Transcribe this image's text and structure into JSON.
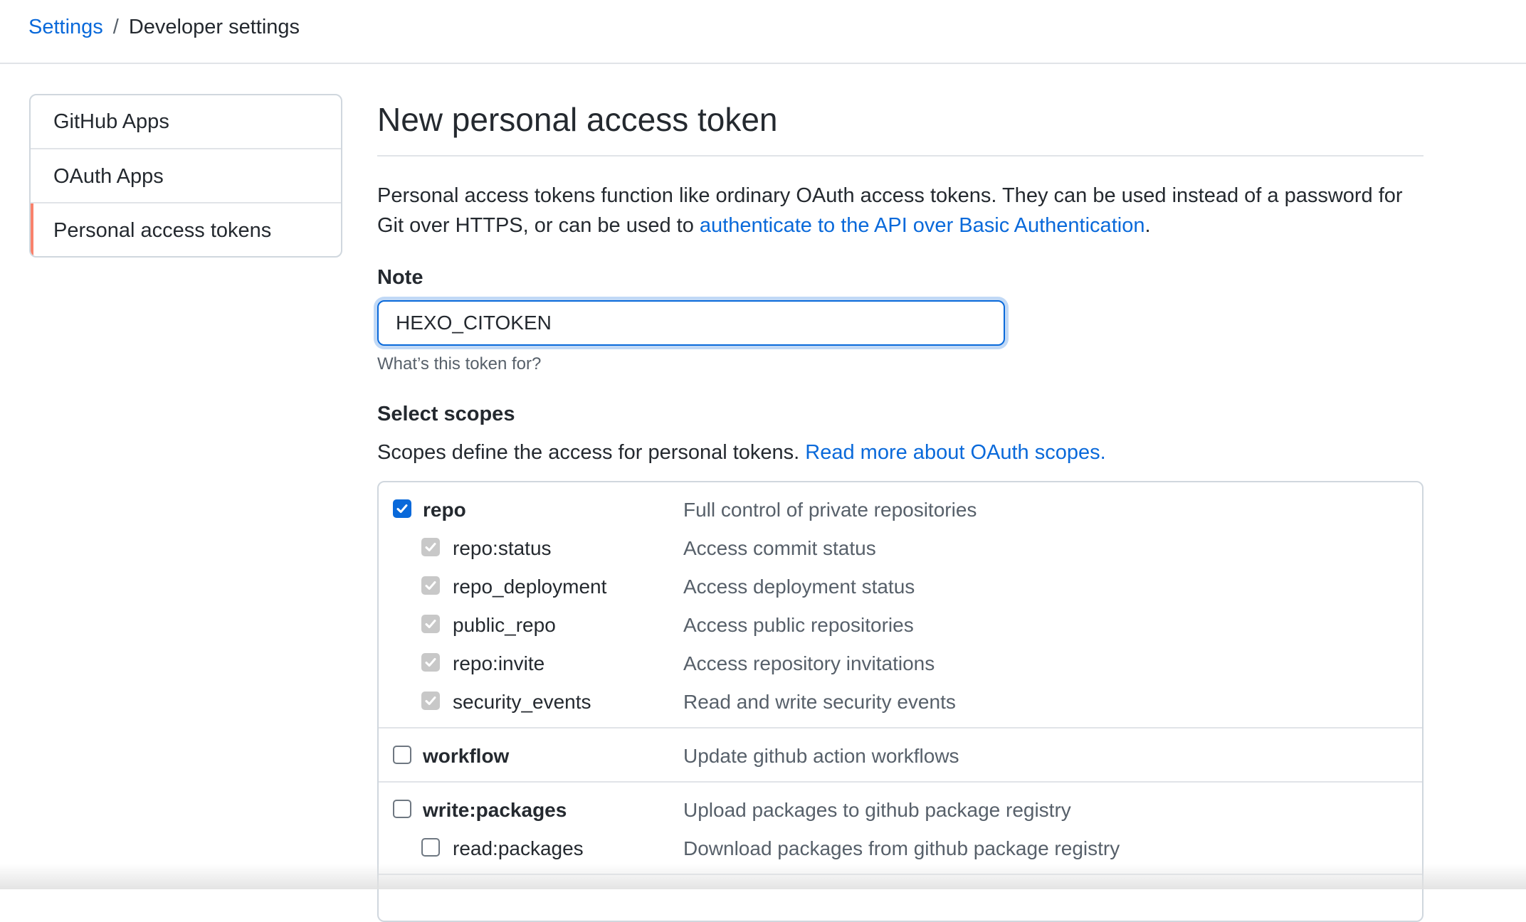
{
  "breadcrumb": {
    "root": "Settings",
    "separator": "/",
    "current": "Developer settings"
  },
  "sidebar": {
    "items": [
      {
        "label": "GitHub Apps",
        "selected": false
      },
      {
        "label": "OAuth Apps",
        "selected": false
      },
      {
        "label": "Personal access tokens",
        "selected": true
      }
    ]
  },
  "main": {
    "title": "New personal access token",
    "intro_text": "Personal access tokens function like ordinary OAuth access tokens. They can be used instead of a password for Git over HTTPS, or can be used to ",
    "intro_link": "authenticate to the API over Basic Authentication",
    "intro_end": ".",
    "note": {
      "label": "Note",
      "value": "HEXO_CITOKEN",
      "help": "What’s this token for?"
    },
    "scopes": {
      "title": "Select scopes",
      "desc": "Scopes define the access for personal tokens. ",
      "link": "Read more about OAuth scopes.",
      "groups": [
        {
          "name": "repo",
          "description": "Full control of private repositories",
          "checked": true,
          "children": [
            {
              "name": "repo:status",
              "description": "Access commit status",
              "checked": true
            },
            {
              "name": "repo_deployment",
              "description": "Access deployment status",
              "checked": true
            },
            {
              "name": "public_repo",
              "description": "Access public repositories",
              "checked": true
            },
            {
              "name": "repo:invite",
              "description": "Access repository invitations",
              "checked": true
            },
            {
              "name": "security_events",
              "description": "Read and write security events",
              "checked": true
            }
          ]
        },
        {
          "name": "workflow",
          "description": "Update github action workflows",
          "checked": false,
          "children": []
        },
        {
          "name": "write:packages",
          "description": "Upload packages to github package registry",
          "checked": false,
          "children": [
            {
              "name": "read:packages",
              "description": "Download packages from github package registry",
              "checked": false
            }
          ]
        }
      ]
    }
  },
  "colors": {
    "link": "#0969da",
    "accent_selected": "#f9826c",
    "text": "#24292f",
    "muted": "#57606a",
    "border": "#d0d7de"
  }
}
